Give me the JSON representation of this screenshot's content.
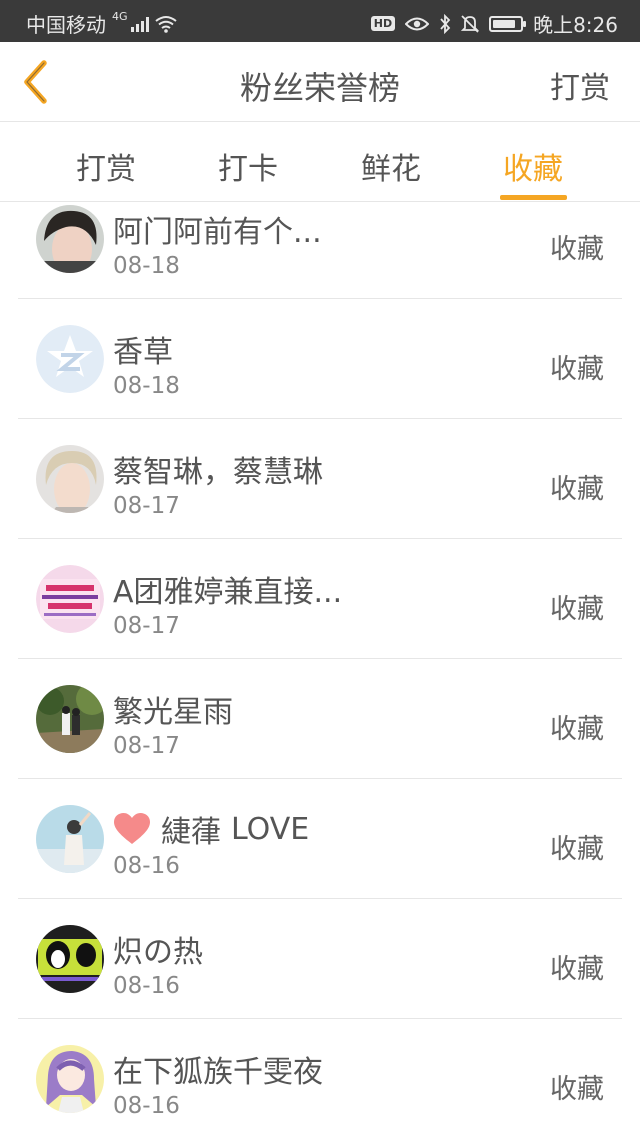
{
  "status_bar": {
    "carrier": "中国移动",
    "network": "4G",
    "time": "晚上8:26",
    "hd_label": "HD",
    "icons": [
      "signal-icon",
      "wifi-icon",
      "hd-icon",
      "eye-icon",
      "bluetooth-icon",
      "mute-bell-icon",
      "battery-icon"
    ],
    "battery_level": 0.85
  },
  "navbar": {
    "back_icon": "chevron-left-icon",
    "title": "粉丝荣誉榜",
    "action_label": "打赏",
    "accent_color": "#f5a623"
  },
  "tabs": [
    {
      "label": "打赏",
      "active": false
    },
    {
      "label": "打卡",
      "active": false
    },
    {
      "label": "鲜花",
      "active": false
    },
    {
      "label": "收藏",
      "active": true
    }
  ],
  "list": [
    {
      "name": "阿门阿前有个...",
      "date": "08-18",
      "action": "收藏",
      "avatar": "portrait-dark-hair"
    },
    {
      "name": "香草",
      "date": "08-18",
      "action": "收藏",
      "avatar": "default-qq-avatar"
    },
    {
      "name": "蔡智琳，蔡慧琳",
      "date": "08-17",
      "action": "收藏",
      "avatar": "portrait-blonde"
    },
    {
      "name": "A团雅婷兼直接...",
      "date": "08-17",
      "action": "收藏",
      "avatar": "recruitment-banner"
    },
    {
      "name": "繁光星雨",
      "date": "08-17",
      "action": "收藏",
      "avatar": "couple-photo"
    },
    {
      "name": "LOVE",
      "name_prefix": "緁葎",
      "date": "08-16",
      "action": "收藏",
      "avatar": "girl-sky",
      "heart": true
    },
    {
      "name": "炽の热",
      "date": "08-16",
      "action": "收藏",
      "avatar": "penguin-banner"
    },
    {
      "name": "在下狐族千雯夜",
      "date": "08-16",
      "action": "收藏",
      "avatar": "anime-girl-purple"
    }
  ]
}
